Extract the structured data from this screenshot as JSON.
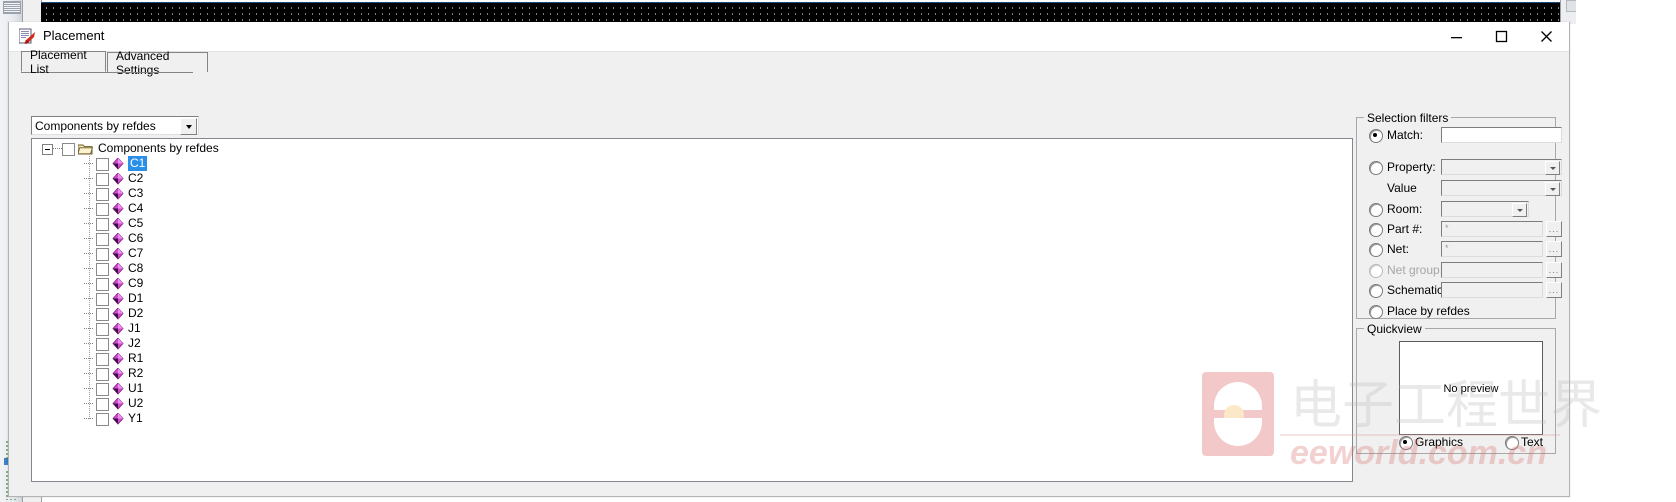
{
  "window": {
    "title": "Placement",
    "icon": "placement-app-icon",
    "controls": [
      {
        "name": "minimize",
        "glyph": "minimize-icon"
      },
      {
        "name": "maximize",
        "glyph": "maximize-icon"
      },
      {
        "name": "close",
        "glyph": "close-icon"
      }
    ]
  },
  "tabs": [
    {
      "label": "Placement List",
      "selected": true
    },
    {
      "label": "Advanced Settings",
      "selected": false
    }
  ],
  "combo": {
    "value": "Components by refdes",
    "icon": "chevron-down-icon"
  },
  "tree": {
    "root": {
      "label": "Components by refdes",
      "icon": "folder-icon",
      "expander": "minus-icon",
      "checked": false
    },
    "items": [
      {
        "label": "C1",
        "selected": true,
        "checked": false,
        "icon": "component-diamond-icon"
      },
      {
        "label": "C2",
        "selected": false,
        "checked": false,
        "icon": "component-diamond-icon"
      },
      {
        "label": "C3",
        "selected": false,
        "checked": false,
        "icon": "component-diamond-icon"
      },
      {
        "label": "C4",
        "selected": false,
        "checked": false,
        "icon": "component-diamond-icon"
      },
      {
        "label": "C5",
        "selected": false,
        "checked": false,
        "icon": "component-diamond-icon"
      },
      {
        "label": "C6",
        "selected": false,
        "checked": false,
        "icon": "component-diamond-icon"
      },
      {
        "label": "C7",
        "selected": false,
        "checked": false,
        "icon": "component-diamond-icon"
      },
      {
        "label": "C8",
        "selected": false,
        "checked": false,
        "icon": "component-diamond-icon"
      },
      {
        "label": "C9",
        "selected": false,
        "checked": false,
        "icon": "component-diamond-icon"
      },
      {
        "label": "D1",
        "selected": false,
        "checked": false,
        "icon": "component-diamond-icon"
      },
      {
        "label": "D2",
        "selected": false,
        "checked": false,
        "icon": "component-diamond-icon"
      },
      {
        "label": "J1",
        "selected": false,
        "checked": false,
        "icon": "component-diamond-icon"
      },
      {
        "label": "J2",
        "selected": false,
        "checked": false,
        "icon": "component-diamond-icon"
      },
      {
        "label": "R1",
        "selected": false,
        "checked": false,
        "icon": "component-diamond-icon"
      },
      {
        "label": "R2",
        "selected": false,
        "checked": false,
        "icon": "component-diamond-icon"
      },
      {
        "label": "U1",
        "selected": false,
        "checked": false,
        "icon": "component-diamond-icon"
      },
      {
        "label": "U2",
        "selected": false,
        "checked": false,
        "icon": "component-diamond-icon"
      },
      {
        "label": "Y1",
        "selected": false,
        "checked": false,
        "icon": "component-diamond-icon"
      }
    ]
  },
  "selection_filters": {
    "title": "Selection filters",
    "rows": [
      {
        "label": "Match:",
        "radio": "on",
        "field": "text",
        "value": "",
        "placeholder": ""
      },
      {
        "label": "Property:",
        "radio": "off",
        "field": "combo",
        "value": "",
        "placeholder": ""
      },
      {
        "label": "Value",
        "radio": "none",
        "field": "combo",
        "value": "",
        "placeholder": ""
      },
      {
        "label": "Room:",
        "radio": "off",
        "field": "combo",
        "value": "",
        "placeholder": ""
      },
      {
        "label": "Part #:",
        "radio": "off",
        "field": "browse",
        "value": "",
        "placeholder": "*"
      },
      {
        "label": "Net:",
        "radio": "off",
        "field": "browse",
        "value": "",
        "placeholder": "*"
      },
      {
        "label": "Net group:",
        "radio": "disabled",
        "field": "browse",
        "value": "",
        "placeholder": ""
      },
      {
        "label": "Schematic page number",
        "radio": "off",
        "field": "browse",
        "value": "",
        "placeholder": ""
      },
      {
        "label": "Place by refdes",
        "radio": "off",
        "field": "none",
        "value": "",
        "placeholder": ""
      }
    ],
    "browse_label": "..."
  },
  "quickview": {
    "title": "Quickview",
    "preview_text": "No preview",
    "modes": [
      {
        "label": "Graphics",
        "selected": true
      },
      {
        "label": "Text",
        "selected": false
      }
    ]
  },
  "watermark": {
    "cn": "电子工程世界",
    "domain": "eeworld.com.cn"
  },
  "colors": {
    "dialog_bg": "#f0f0f0",
    "selection_blue": "#2a8fe8",
    "component_magenta": "#d44ad4",
    "titlebar": "#ffffff"
  }
}
